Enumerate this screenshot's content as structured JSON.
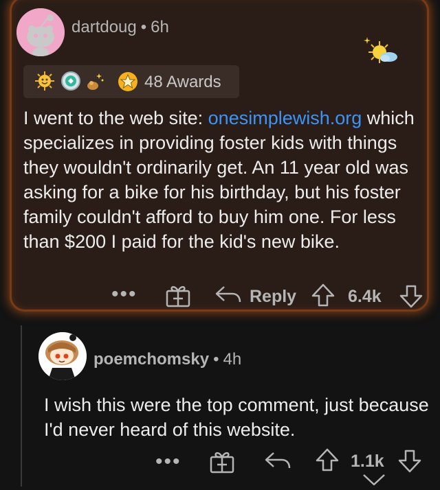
{
  "comment1": {
    "username": "dartdoug",
    "separator": "•",
    "age": "6h",
    "awards_label": "48 Awards",
    "body_prefix": "I went to the web site: ",
    "body_link": "onesimplewish.org",
    "body_suffix": " which specializes in providing foster kids with things they wouldn't ordinarily get. An 11 year old was asking for a bike for his birthday, but his foster family couldn't afford to buy him one.  For less than $200 I paid for the kid's new bike.",
    "actions": {
      "more": "•••",
      "reply_label": "Reply",
      "score": "6.4k"
    },
    "awards_icons": [
      "sun-award-icon",
      "wholesome-award-icon",
      "silver-award-icon",
      "helpful-award-icon",
      "star-award-icon"
    ]
  },
  "comment2": {
    "username": "poemchomsky",
    "separator": "•",
    "age": "4h",
    "body": "I wish this were the top comment, just because I'd never heard of this website.",
    "actions": {
      "more": "•••",
      "score": "1.1k"
    }
  },
  "colors": {
    "background": "#131313",
    "gilded_card": "#2a1d17",
    "gilded_glow": "#c45c1a",
    "link": "#3d94f6",
    "muted_text": "#b5b5b5"
  }
}
